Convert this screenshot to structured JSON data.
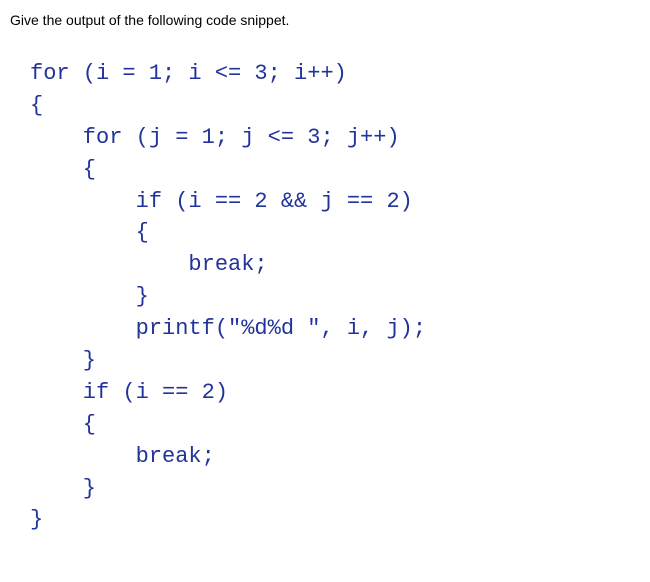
{
  "question": "Give the output of the following code snippet.",
  "code": {
    "line1": "for (i = 1; i <= 3; i++)",
    "line2": "{",
    "line3": "    for (j = 1; j <= 3; j++)",
    "line4": "    {",
    "line5": "        if (i == 2 && j == 2)",
    "line6": "        {",
    "line7": "            break;",
    "line8": "        }",
    "line9": "        printf(\"%d%d \", i, j);",
    "line10": "    }",
    "line11": "    if (i == 2)",
    "line12": "    {",
    "line13": "        break;",
    "line14": "    }",
    "line15": "}"
  }
}
